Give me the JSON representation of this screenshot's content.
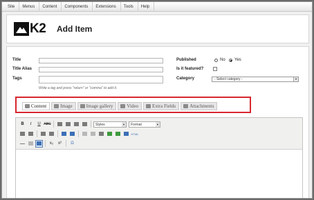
{
  "topmenu": [
    "Site",
    "Menus",
    "Content",
    "Components",
    "Extensions",
    "Tools",
    "Help"
  ],
  "header": {
    "logo_text": "K2",
    "title": "Add Item"
  },
  "form": {
    "title_label": "Title",
    "alias_label": "Title Alias",
    "tags_label": "Tags",
    "tags_hint": "Write a tag and press \"return\" or \"comma\" to add it.",
    "published_label": "Published",
    "published_no": "No",
    "published_yes": "Yes",
    "published_value": "Yes",
    "featured_label": "Is it featured?",
    "featured_checked": false,
    "category_label": "Category",
    "category_value": "- Select category -"
  },
  "tabs": [
    {
      "label": "Content",
      "icon": "content-icon",
      "active": true
    },
    {
      "label": "Image",
      "icon": "image-icon",
      "active": false
    },
    {
      "label": "Image gallery",
      "icon": "gallery-icon",
      "active": false
    },
    {
      "label": "Video",
      "icon": "video-icon",
      "active": false
    },
    {
      "label": "Extra Fields",
      "icon": "extra-fields-icon",
      "active": false
    },
    {
      "label": "Attachments",
      "icon": "attachments-icon",
      "active": false
    }
  ],
  "editor": {
    "bold": "B",
    "italic": "I",
    "underline": "U",
    "strike": "ABC",
    "styles_value": "Styles",
    "format_value": "Format",
    "html_label": "HTML",
    "subscript": "x₂",
    "superscript": "x²",
    "omega": "Ω"
  },
  "colors": {
    "highlight_border": "#d7262c",
    "background": "#ffffff"
  }
}
